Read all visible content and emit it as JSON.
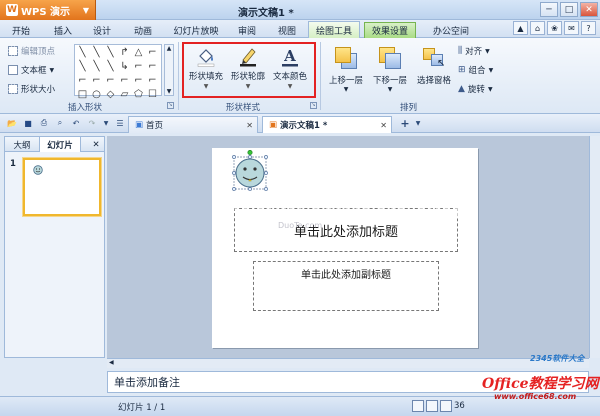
{
  "app": {
    "name": "WPS 演示",
    "logo_char": "W",
    "document_title": "演示文稿1 *"
  },
  "window_controls": [
    "─",
    "□",
    "✕"
  ],
  "menu": {
    "tabs": [
      "开始",
      "插入",
      "设计",
      "动画",
      "幻灯片放映",
      "审阅",
      "视图",
      "绘图工具",
      "效果设置",
      "办公空间"
    ],
    "right_icons": [
      "▲",
      "⌂",
      "❀",
      "✉",
      "?"
    ]
  },
  "ribbon": {
    "insert_shapes": {
      "edit_points": "编辑顶点",
      "text_box": "文本框",
      "shape_size": "形状大小",
      "label": "插入形状",
      "shape_glyphs": [
        "╲",
        "╲",
        "╲",
        "↱",
        "△",
        "⌐",
        "╲",
        "╲",
        "╲",
        "↳",
        "⌐",
        "⌐",
        "⌐",
        "⌐",
        "⌐",
        "⌐",
        "⌐",
        "⌐",
        "□",
        "○",
        "◇",
        "▱",
        "⬠",
        "☐"
      ]
    },
    "shape_style": {
      "fill": "形状填充",
      "outline": "形状轮廓",
      "text_color": "文本颜色",
      "label": "形状样式"
    },
    "arrange": {
      "bring_forward": "上移一层",
      "send_backward": "下移一层",
      "selection_pane": "选择窗格",
      "align": "对齐",
      "group": "组合",
      "rotate": "旋转",
      "label": "排列"
    }
  },
  "doc_tabs": [
    "首页",
    "演示文稿1 *"
  ],
  "left_pane": {
    "tabs": [
      "大纲",
      "幻灯片"
    ],
    "slide_number": "1"
  },
  "slide": {
    "title_placeholder": "单击此处添加标题",
    "subtitle_placeholder": "单击此处添加副标题"
  },
  "notes": "单击添加备注",
  "status": {
    "slide_counter": "幻灯片 1 / 1",
    "zoom": "36"
  },
  "watermarks": {
    "duote": "www.DuoTe.com",
    "duote_small": "DuoTe.com",
    "site_2345": "2345软件大全",
    "office": "Office教程学习网",
    "office_url": "www.office68.com"
  },
  "colors": {
    "highlight_red": "#e32222",
    "app_orange": "#e2741c",
    "context_tab_green": "#a9dc86",
    "selected_slide_border": "#f0b72d"
  }
}
